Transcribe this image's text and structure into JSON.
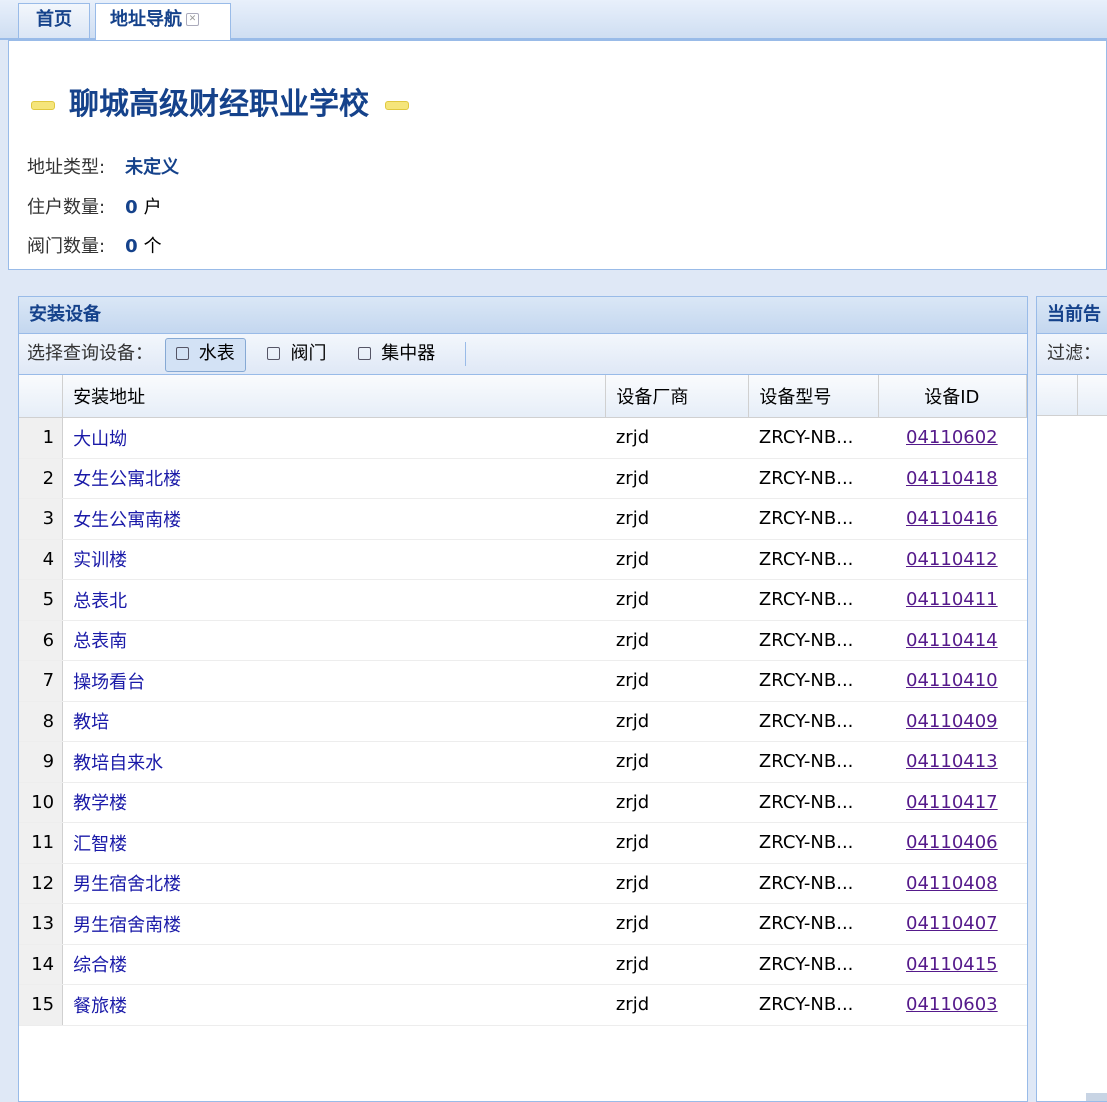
{
  "tabs": [
    {
      "label": "首页"
    },
    {
      "label": "地址导航"
    }
  ],
  "info": {
    "title": "聊城高级财经职业学校",
    "address_type_label": "地址类型:",
    "address_type_value": "未定义",
    "households_label": "住户数量:",
    "households_value": "0",
    "households_unit": "户",
    "valves_label": "阀门数量:",
    "valves_value": "0",
    "valves_unit": "个"
  },
  "devices_panel": {
    "title": "安装设备",
    "toolbar_label": "选择查询设备：",
    "buttons": [
      {
        "label": "水表",
        "pressed": true,
        "icon": "water-meter-icon"
      },
      {
        "label": "阀门",
        "pressed": false,
        "icon": "valve-icon"
      },
      {
        "label": "集中器",
        "pressed": false,
        "icon": "concentrator-icon"
      }
    ],
    "columns": [
      "安装地址",
      "设备厂商",
      "设备型号",
      "设备ID"
    ],
    "rows": [
      {
        "n": "1",
        "address": "大山坳",
        "vendor": "zrjd",
        "model": "ZRCY-NB...",
        "id": "04110602"
      },
      {
        "n": "2",
        "address": "女生公寓北楼",
        "vendor": "zrjd",
        "model": "ZRCY-NB...",
        "id": "04110418"
      },
      {
        "n": "3",
        "address": "女生公寓南楼",
        "vendor": "zrjd",
        "model": "ZRCY-NB...",
        "id": "04110416"
      },
      {
        "n": "4",
        "address": "实训楼",
        "vendor": "zrjd",
        "model": "ZRCY-NB...",
        "id": "04110412"
      },
      {
        "n": "5",
        "address": "总表北",
        "vendor": "zrjd",
        "model": "ZRCY-NB...",
        "id": "04110411"
      },
      {
        "n": "6",
        "address": "总表南",
        "vendor": "zrjd",
        "model": "ZRCY-NB...",
        "id": "04110414"
      },
      {
        "n": "7",
        "address": "操场看台",
        "vendor": "zrjd",
        "model": "ZRCY-NB...",
        "id": "04110410"
      },
      {
        "n": "8",
        "address": "教培",
        "vendor": "zrjd",
        "model": "ZRCY-NB...",
        "id": "04110409"
      },
      {
        "n": "9",
        "address": "教培自来水",
        "vendor": "zrjd",
        "model": "ZRCY-NB...",
        "id": "04110413"
      },
      {
        "n": "10",
        "address": "教学楼",
        "vendor": "zrjd",
        "model": "ZRCY-NB...",
        "id": "04110417"
      },
      {
        "n": "11",
        "address": "汇智楼",
        "vendor": "zrjd",
        "model": "ZRCY-NB...",
        "id": "04110406"
      },
      {
        "n": "12",
        "address": "男生宿舍北楼",
        "vendor": "zrjd",
        "model": "ZRCY-NB...",
        "id": "04110408"
      },
      {
        "n": "13",
        "address": "男生宿舍南楼",
        "vendor": "zrjd",
        "model": "ZRCY-NB...",
        "id": "04110407"
      },
      {
        "n": "14",
        "address": "综合楼",
        "vendor": "zrjd",
        "model": "ZRCY-NB...",
        "id": "04110415"
      },
      {
        "n": "15",
        "address": "餐旅楼",
        "vendor": "zrjd",
        "model": "ZRCY-NB...",
        "id": "04110603"
      }
    ]
  },
  "alerts_panel": {
    "title": "当前告",
    "filter_label": "过滤："
  }
}
